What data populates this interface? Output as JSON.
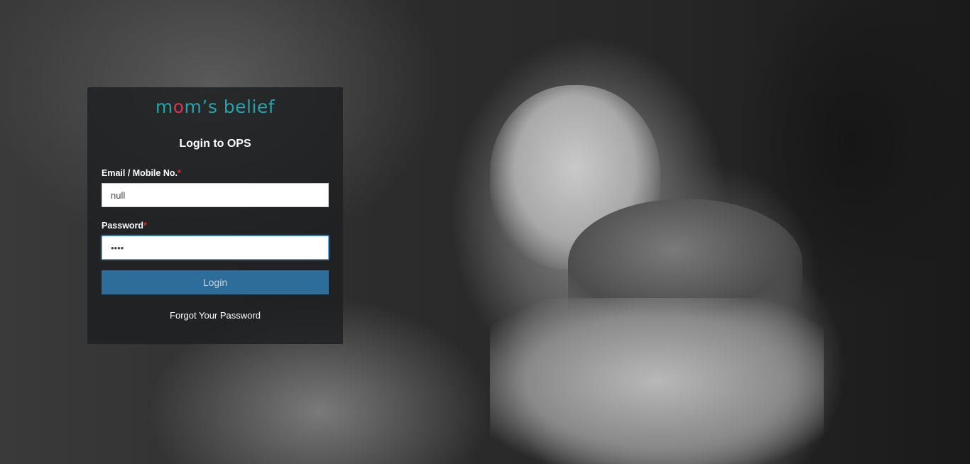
{
  "brand": {
    "logo_prefix": "m",
    "logo_dot": "o",
    "logo_suffix": "m’s belief",
    "color": "#24a3a8",
    "dot_color": "#d8344f"
  },
  "login": {
    "title": "Login to OPS",
    "email_label": "Email / Mobile No.",
    "email_value": "null",
    "password_label": "Password",
    "password_value": "1234",
    "required_mark": "*",
    "login_button": "Login",
    "forgot_link": "Forgot Your Password"
  },
  "colors": {
    "panel_bg": "rgba(28,30,33,0.82)",
    "button_bg": "#2e6d99",
    "required": "#e02b2b"
  }
}
